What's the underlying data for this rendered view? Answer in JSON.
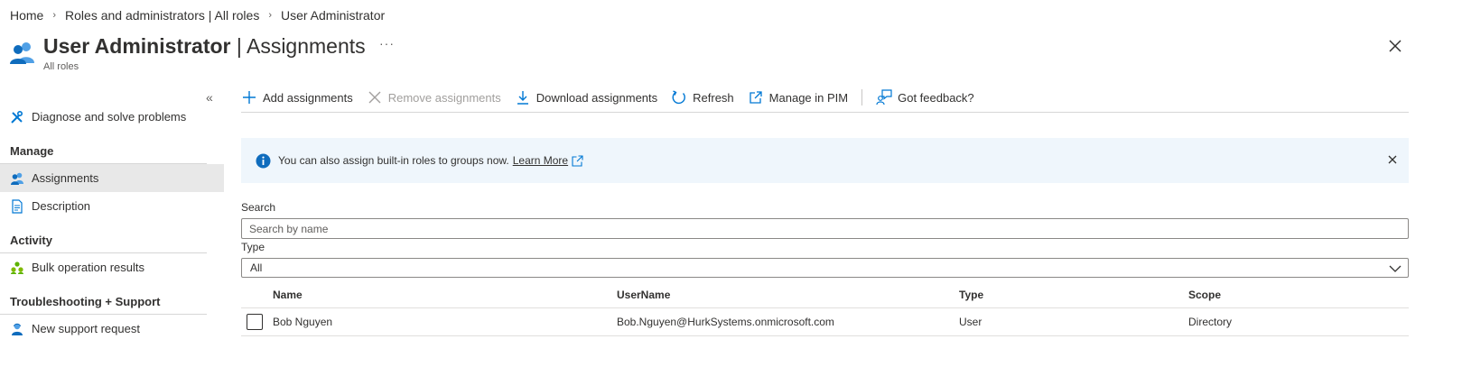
{
  "breadcrumb": {
    "items": [
      "Home",
      "Roles and administrators | All roles",
      "User Administrator"
    ]
  },
  "header": {
    "title_strong": "User Administrator",
    "title_sep": " | ",
    "title_rest": "Assignments",
    "more": "···",
    "subtitle": "All roles",
    "icon": "users-role-icon"
  },
  "sidebar": {
    "top_item": {
      "label": "Diagnose and solve problems",
      "icon": "wrench-screwdriver-icon"
    },
    "sections": [
      {
        "title": "Manage",
        "items": [
          {
            "label": "Assignments",
            "icon": "users-icon",
            "active": true
          },
          {
            "label": "Description",
            "icon": "document-icon",
            "active": false
          }
        ]
      },
      {
        "title": "Activity",
        "items": [
          {
            "label": "Bulk operation results",
            "icon": "bulk-users-icon",
            "active": false
          }
        ]
      },
      {
        "title": "Troubleshooting + Support",
        "items": [
          {
            "label": "New support request",
            "icon": "support-person-icon",
            "active": false
          }
        ]
      }
    ]
  },
  "toolbar": {
    "add": "Add assignments",
    "remove": "Remove assignments",
    "download": "Download assignments",
    "refresh": "Refresh",
    "pim": "Manage in PIM",
    "feedback": "Got feedback?"
  },
  "info": {
    "message": "You can also assign built-in roles to groups now.",
    "link": "Learn More"
  },
  "search": {
    "label": "Search",
    "placeholder": "Search by name"
  },
  "type_filter": {
    "label": "Type",
    "selected": "All"
  },
  "table": {
    "columns": [
      "Name",
      "UserName",
      "Type",
      "Scope"
    ],
    "rows": [
      {
        "name": "Bob Nguyen",
        "username": "Bob.Nguyen@HurkSystems.onmicrosoft.com",
        "type": "User",
        "scope": "Directory"
      }
    ]
  },
  "colors": {
    "accent": "#0078d4",
    "info_bg": "#eff6fc",
    "active_nav": "#e8e8e8",
    "disabled": "#a19f9d"
  }
}
